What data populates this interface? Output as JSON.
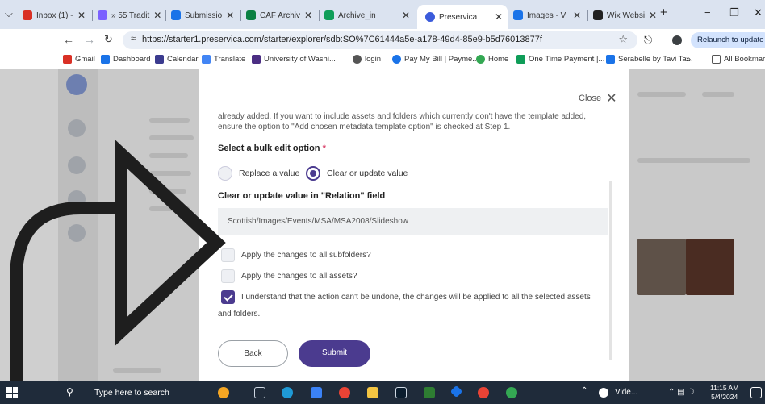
{
  "browser": {
    "tabs": [
      {
        "label": "Inbox (1) -",
        "icon": "gmail-icon",
        "color": "#d93025"
      },
      {
        "label": "» 55 Tradit",
        "icon": "bookmark-tab-icon",
        "color": "#7b61ff"
      },
      {
        "label": "Submissio",
        "icon": "document-tab-icon",
        "color": "#1a73e8"
      },
      {
        "label": "CAF Archiv",
        "icon": "archive-tab-icon",
        "color": "#0b8043"
      },
      {
        "label": "Archive_in",
        "icon": "sheets-tab-icon",
        "color": "#0f9d58"
      },
      {
        "label": "Preservica",
        "icon": "preservica-tab-icon",
        "color": "#3b5bdb",
        "active": true
      },
      {
        "label": "Images - V",
        "icon": "images-tab-icon",
        "color": "#1a73e8"
      },
      {
        "label": "Wix Websi",
        "icon": "wix-tab-icon",
        "color": "#222222"
      }
    ],
    "new_tab": "+",
    "window": {
      "minimize": "−",
      "maximize": "❐",
      "close": "✕"
    },
    "url": "https://starter1.preservica.com/starter/explorer/sdb:SO%7C61444a5e-a178-49d4-85e9-b5d76013877f",
    "relaunch_label": "Relaunch to update",
    "bookmarks": [
      {
        "label": "Gmail",
        "color": "#d93025"
      },
      {
        "label": "Dashboard",
        "color": "#1a73e8"
      },
      {
        "label": "Calendar",
        "color": "#3b3b8f"
      },
      {
        "label": "Translate",
        "color": "#4285f4"
      },
      {
        "label": "University of Washi...",
        "color": "#4b2e83"
      },
      {
        "label": "login",
        "color": "#555555"
      },
      {
        "label": "Pay My Bill | Payme...",
        "color": "#1a73e8"
      },
      {
        "label": "Home",
        "color": "#34a853"
      },
      {
        "label": "One Time Payment |...",
        "color": "#0f9d58"
      },
      {
        "label": "Serabelle by Tavi Ta...",
        "color": "#1a73e8"
      }
    ],
    "bookmarks_overflow": "»",
    "all_bookmarks": "All Bookmarks"
  },
  "modal": {
    "close_label": "Close",
    "intro_text": "already added. If you want to include assets and folders which currently don't have the template added, ensure the option to \"Add chosen metadata template option\" is checked at Step 1.",
    "bulk_heading": "Select a bulk edit option",
    "required_mark": "*",
    "options": [
      {
        "label": "Replace a value",
        "selected": false
      },
      {
        "label": "Clear or update value",
        "selected": true
      }
    ],
    "field_heading": "Clear or update value in \"Relation\" field",
    "field_value": "Scottish/Images/Events/MSA/MSA2008/Slideshow",
    "checkboxes": [
      {
        "label": "Apply the changes to all subfolders?",
        "checked": false
      },
      {
        "label": "Apply the changes to all assets?",
        "checked": false
      },
      {
        "label": "I understand that the action can't be undone, the changes will be applied to all the selected assets",
        "checked": true
      }
    ],
    "ack_continuation": "and folders.",
    "back_label": "Back",
    "submit_label": "Submit",
    "accent_color": "#4b3b8f"
  },
  "taskbar": {
    "search_placeholder": "Type here to search",
    "video_label": "Vide...",
    "time": "11:15 AM",
    "date": "5/4/2024"
  }
}
